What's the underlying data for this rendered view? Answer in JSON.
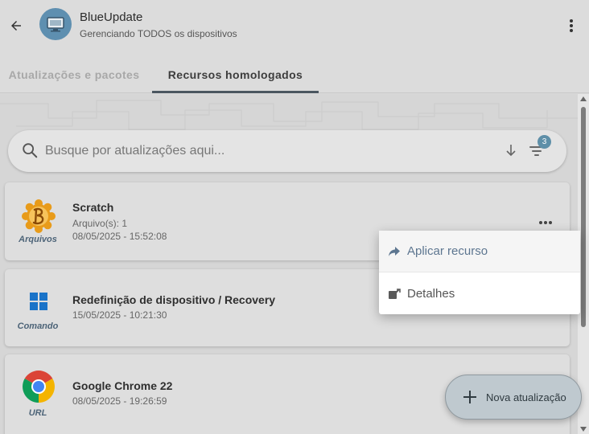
{
  "header": {
    "app_title": "BlueUpdate",
    "app_subtitle": "Gerenciando TODOS os dispositivos",
    "back_icon": "arrow-left-icon",
    "avatar_icon": "monitor-icon",
    "menu_icon": "kebab-menu-icon"
  },
  "tabs": [
    {
      "label": "Atualizações e pacotes",
      "active": false
    },
    {
      "label": "Recursos homologados",
      "active": true
    }
  ],
  "search": {
    "placeholder": "Busque por atualizações aqui...",
    "value": "",
    "filter_badge": "3"
  },
  "items": [
    {
      "title": "Scratch",
      "meta": [
        "Arquivo(s): 1",
        "08/05/2025 - 15:52:08"
      ],
      "type": "Arquivos",
      "icon": "scratch-icon"
    },
    {
      "title": "Redefinição de dispositivo / Recovery",
      "meta": [
        "15/05/2025 - 10:21:30"
      ],
      "type": "Comando",
      "icon": "windows-icon"
    },
    {
      "title": "Google Chrome 22",
      "meta": [
        "08/05/2025 - 19:26:59"
      ],
      "type": "URL",
      "icon": "chrome-icon"
    }
  ],
  "context_menu": {
    "items": [
      {
        "label": "Aplicar recurso",
        "icon": "share-arrow-icon"
      },
      {
        "label": "Detalhes",
        "icon": "edit-icon"
      }
    ]
  },
  "fab": {
    "label": "Nova atualização",
    "icon": "plus-icon"
  },
  "colors": {
    "accent": "#5e8fa8",
    "tab_indicator": "#4b5660",
    "type_label": "#4d6478"
  }
}
